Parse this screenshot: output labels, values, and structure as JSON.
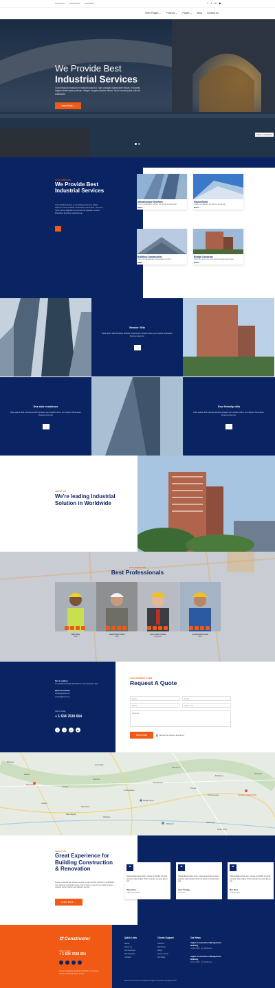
{
  "topbar": {
    "links": [
      "SUPPORT",
      "PARTNERS",
      "CAREERS"
    ],
    "social_icons": [
      "twitter-icon",
      "facebook-icon",
      "linkedin-icon",
      "youtube-icon"
    ]
  },
  "nav": {
    "items": [
      "Inner Pages",
      "Projects",
      "Pages",
      "Blog",
      "Contact us"
    ]
  },
  "hero": {
    "title_line1": "We Provide Best",
    "title_line2": "Industrial Services",
    "text": "Cras tincidunt massa in ex blandit euismod. Nam volutpat ullamcorper neque, in lobortis magna ullamcorper pulvinar. Integer congue sodales dictum. Nunc laoreet porta nulla at sollicitudin.",
    "button": "Learn More →",
    "badge": "Made in Webflow",
    "slide_count": 2
  },
  "services": {
    "tag": "OUR SERVICES",
    "title": "We Provide Best Industrial Services",
    "paragraph": "Cras tincidunt luctus at est tristique rhoncus. Etiam dapibus nisl urna lacus consectetur accumsan. Vivamus risus cursus dignissim commodo sit egestas id amet. Phasellus faucibus pellentesque.",
    "arrow": "→",
    "cards": [
      {
        "title": "Infrastructure Services",
        "desc": "Fusce in bibendum tempus vel sed amet accumsan.",
        "link": "Read  →"
      },
      {
        "title": "House Build",
        "desc": "Integer vel aliquam elit tempus accumsan.",
        "link": "Read  →"
      },
      {
        "title": "Building Construction",
        "desc": "Nunc est repudiandae consequatur nisi nihil.",
        "link": "Read  →"
      },
      {
        "title": "Bridge Construct",
        "desc": "Nulla nec eros amet ante ornare tincidunt accumsan.",
        "link": "Read  →"
      }
    ]
  },
  "grid": {
    "blocks": [
      {
        "title": "Mostor Villa",
        "desc": "Class aptent taciti sociosqu ad litora torquent per conubia nostra, per inceptos himenaeos. Vivamus risus nisi.",
        "btn": "→"
      },
      {
        "title": "Sea side residence",
        "desc": "Class aptent taciti sociosqu ad litora torquent per conubia nostra, per inceptos himenaeos. Vivamus risus nisi.",
        "btn": "→"
      },
      {
        "title": "Eco friendly villa",
        "desc": "Class aptent taciti sociosqu ad litora torquent per conubia nostra, per inceptos himenaeos. Vivamus risus nisi.",
        "btn": "→"
      }
    ]
  },
  "leading": {
    "tag": "ABOUT US",
    "title": "We're leading Industrial Solution in Worldwide"
  },
  "professionals": {
    "tag": "OUR WORKERS",
    "title": "Best Professionals",
    "people": [
      {
        "name": "Niko Vary",
        "role": "CEO"
      },
      {
        "name": "Gagrichand Sana",
        "role": "CEO"
      },
      {
        "name": "Juan Jose Octave",
        "role": "Engineer"
      },
      {
        "name": "Condraria Dursad",
        "role": "CEO"
      }
    ]
  },
  "contact": {
    "location_label": "Our Location",
    "location_value": "Thunderbird, Details 90-97Cl0e dn, Los Angeles, USA",
    "quick_label": "Quick Contacts",
    "emails": [
      "contact@mail.com",
      "contact@mail.com"
    ],
    "call_label": "Call us Today",
    "phone": "+ 1 634 7630 654",
    "social_icons": [
      "twitter-icon",
      "facebook-icon",
      "linkedin-icon",
      "youtube-icon"
    ],
    "form_tag": "APPOINTMENT FORM",
    "form_title": "Request A Quote",
    "fields": {
      "name": "Name",
      "email": "Email",
      "phone": "Phone",
      "select": "Select Line...",
      "message": "Message"
    },
    "send": "Send Now",
    "privacy": "I accept the privacy and terms"
  },
  "map": {
    "labels": [
      "Binaula",
      "Bantiawa",
      "Ancorgay",
      "Mumuna",
      "Barilla",
      "Keshod",
      "Bhadsua",
      "Saranji",
      "Kandasara",
      "Puniyabaori",
      "Pindar",
      "Devaliya Safari Park",
      "Bikaji Plaza",
      "Shrinavasan",
      "Dhanwa",
      "Mandhar",
      "Mandrgeta",
      "Wankia",
      "Bhitwuri",
      "Waranpur",
      "Khair Dhar",
      "Lalkoh"
    ]
  },
  "great": {
    "tag": "ABOUT US",
    "title": "Great Experience for Building Construction & Renovation",
    "paragraph": "Fusce vel iaculis leo. Aenean et ante et felis rhoncus tincidunt in sollicitudin nisi. Quisque eu blandit massa. Sed et turpis, euismod non eleifend quam volutpat sed at. Nullam sed aliquam semper.",
    "button": "Learn More →",
    "testimonials": [
      {
        "q": "“",
        "text": "Suspendisse luctus enim, varius et porttitor sit amet, posuere vitae ninque. Proin ac quam ex amet ipsum egl.",
        "author": "Ruby Grew",
        "role": "CEO Gust Lawarrix"
      },
      {
        "q": "“",
        "text": "Suspendisse luctus enim, varius et porttitor sit amet, posuere vitae ninque. Proin ac quam ex amet ipsum egl.",
        "author": "Juan Cortagg",
        "role": "Consumer"
      },
      {
        "q": "“",
        "text": "Suspendisse luctus enim, varius et porttitor sit amet, posuere vitae ninque. Proin ac quam ex amet ipsum egl.",
        "author": "Mao Zhou",
        "role": "Jodie Gangrei"
      }
    ]
  },
  "footer": {
    "logo": "Constructor",
    "call_label": "Call us Today",
    "phone": "+ 1 634 7630 654",
    "social_icons": [
      "twitter-icon",
      "facebook-icon",
      "linkedin-icon",
      "youtube-icon"
    ],
    "about": "Fusce vel aliquam gravida velit efficitur vel massa. Vivamus vehicula augue a tidurt.",
    "quick_links": {
      "heading": "Quick Links",
      "items": [
        "Home",
        "About us",
        "Our Services",
        "Our Projects",
        "Contact"
      ]
    },
    "clients": {
      "heading": "Clients Support",
      "items": [
        "Careers",
        "Our Team",
        "FAQs",
        "Get In Touch",
        "Our Blog"
      ]
    },
    "news": {
      "heading": "Our News",
      "items": [
        {
          "title": "Agiles Construction Management Building",
          "date": "23 Nov 2020",
          "tag": "by: Webflow-io"
        },
        {
          "title": "Agiles Construction Management Building",
          "date": "23 Nov 2020",
          "tag": "by: Webflow-io"
        }
      ]
    },
    "copyright": "Memorizer © Ecuino Template All rights reserved Copyrights 2020"
  }
}
